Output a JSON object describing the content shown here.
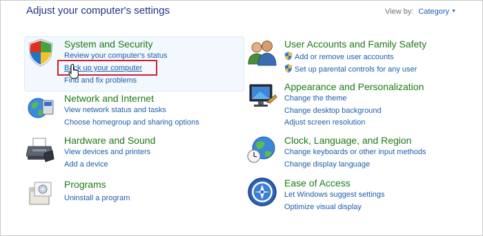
{
  "header": {
    "title": "Adjust your computer's settings",
    "view_by_label": "View by:",
    "view_by_value": "Category"
  },
  "categories": {
    "system": {
      "title": "System and Security",
      "links": [
        "Review your computer's status",
        "Back up your computer",
        "Find and fix problems"
      ]
    },
    "network": {
      "title": "Network and Internet",
      "links": [
        "View network status and tasks",
        "Choose homegroup and sharing options"
      ]
    },
    "hardware": {
      "title": "Hardware and Sound",
      "links": [
        "View devices and printers",
        "Add a device"
      ]
    },
    "programs": {
      "title": "Programs",
      "links": [
        "Uninstall a program"
      ]
    },
    "accounts": {
      "title": "User Accounts and Family Safety",
      "links": [
        "Add or remove user accounts",
        "Set up parental controls for any user"
      ]
    },
    "appearance": {
      "title": "Appearance and Personalization",
      "links": [
        "Change the theme",
        "Change desktop background",
        "Adjust screen resolution"
      ]
    },
    "clock": {
      "title": "Clock, Language, and Region",
      "links": [
        "Change keyboards or other input methods",
        "Change display language"
      ]
    },
    "ease": {
      "title": "Ease of Access",
      "links": [
        "Let Windows suggest settings",
        "Optimize visual display"
      ]
    }
  },
  "colors": {
    "title_blue": "#1e3287",
    "category_green": "#1c7a14",
    "link_blue": "#1d5dab",
    "highlight_red": "#cc1f2e"
  },
  "icons": [
    "security-shield-icon",
    "network-globe-icon",
    "printer-icon",
    "programs-icon",
    "users-icon",
    "appearance-monitor-icon",
    "clock-globe-icon",
    "ease-of-access-icon",
    "uac-shield-icon",
    "hand-cursor-icon"
  ]
}
